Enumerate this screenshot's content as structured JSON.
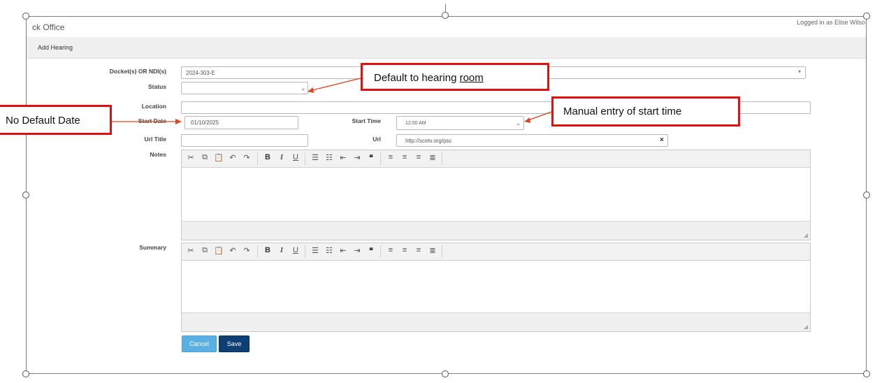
{
  "app": {
    "title": "ck Office",
    "logged_in": "Logged in as Elise Wilso"
  },
  "panel": {
    "title": "Add Hearing"
  },
  "form": {
    "docket_label": "Docket(s) OR NDI(s)",
    "docket_value": "2024-303-E",
    "status_label": "Status",
    "status_value": "",
    "location_label": "Location",
    "location_value": "",
    "start_date_label": "Start Date",
    "start_date_value": "01/10/2025",
    "start_time_label": "Start Time",
    "start_time_value": "12:00 AM",
    "url_title_label": "Url Title",
    "url_title_value": "",
    "url_label": "Url",
    "url_value": "http://scetv.org/psc",
    "notes_label": "Notes",
    "summary_label": "Summary"
  },
  "toolbar_icons": [
    "cut-icon",
    "copy-icon",
    "paste-icon",
    "undo-icon",
    "redo-icon",
    "bold-icon",
    "italic-icon",
    "underline-icon",
    "bullet-list-icon",
    "numbered-list-icon",
    "outdent-icon",
    "indent-icon",
    "blockquote-icon",
    "align-left-icon",
    "align-center-icon",
    "align-right-icon",
    "justify-icon"
  ],
  "buttons": {
    "cancel": "Cancel",
    "save": "Save"
  },
  "callouts": {
    "default_room_prefix": "Default to hearing ",
    "default_room_link": "room",
    "manual_time": "Manual entry of start time",
    "no_default_date": "No Default Date"
  }
}
